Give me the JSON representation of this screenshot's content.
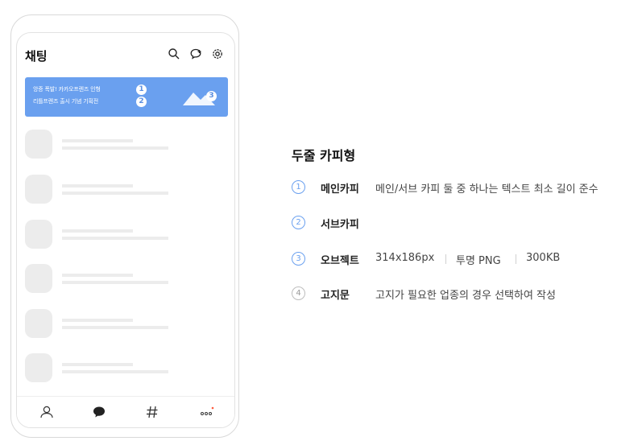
{
  "phone": {
    "title": "채팅",
    "banner": {
      "line1": "앙증 폭발! 카카오프렌즈 인형",
      "line2": "리틀프렌즈 출시 기념 기획전",
      "badge1": "1",
      "badge2": "2",
      "badge3": "3",
      "color": "#6aa0ef"
    },
    "icons": [
      "search-icon",
      "new-chat-icon",
      "settings-icon"
    ],
    "tabs": [
      "friends-icon",
      "chats-icon",
      "hashtag-icon",
      "more-icon"
    ]
  },
  "legend": {
    "title": "두줄 카피형",
    "items": [
      {
        "num": "1",
        "label": "메인카피",
        "desc": "메인/서브 카피 둘 중 하나는 텍스트 최소 길이 준수"
      },
      {
        "num": "2",
        "label": "서브카피",
        "desc": ""
      },
      {
        "num": "3",
        "label": "오브젝트",
        "desc1": "314x186px",
        "desc2": "투명 PNG",
        "desc3": "300KB"
      },
      {
        "num": "4",
        "label": "고지문",
        "desc": "고지가 필요한 업종의 경우 선택하여 작성"
      }
    ]
  }
}
